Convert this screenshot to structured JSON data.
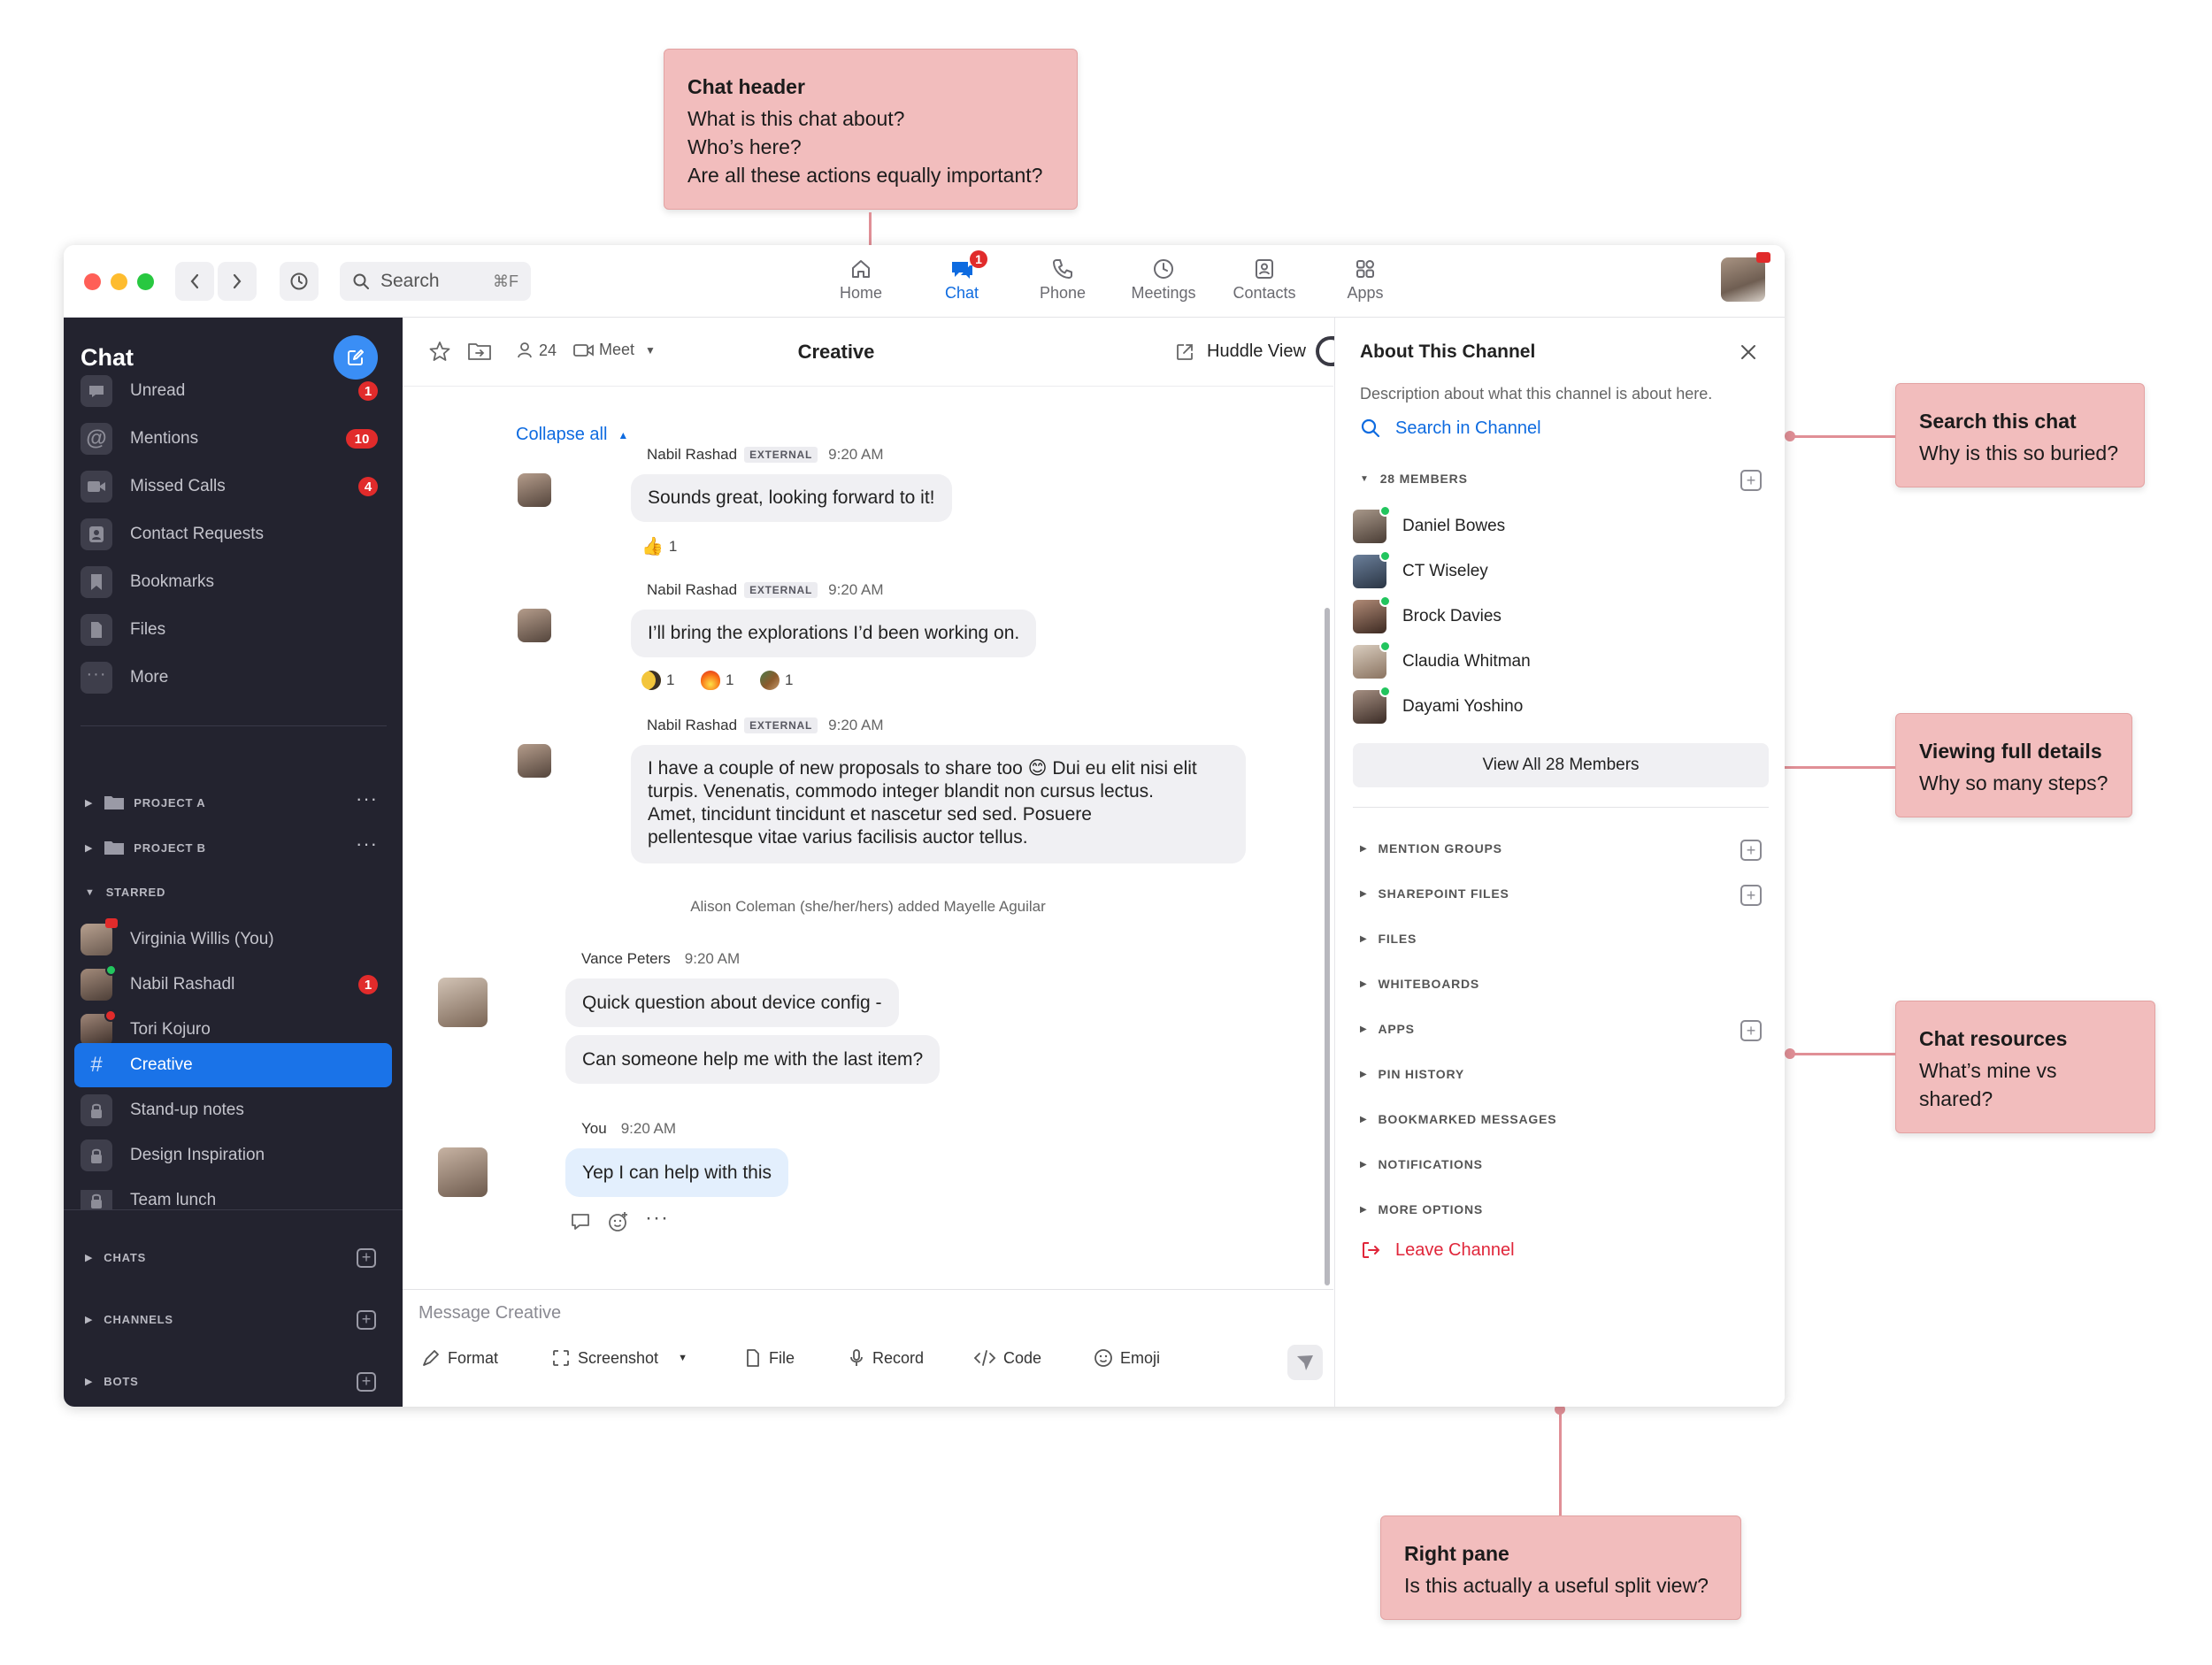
{
  "annotations": [
    {
      "id": "chat-header",
      "title": "Chat header",
      "lines": [
        "What is this chat about?",
        "Who’s here?",
        "Are all these actions equally important?"
      ]
    },
    {
      "id": "search-chat",
      "title": "Search this chat",
      "lines": [
        "Why is this so buried?"
      ]
    },
    {
      "id": "full-details",
      "title": "Viewing full details",
      "lines": [
        "Why so many steps?"
      ]
    },
    {
      "id": "chat-resources",
      "title": "Chat resources",
      "lines": [
        "What’s mine vs shared?"
      ]
    },
    {
      "id": "right-pane",
      "title": "Right pane",
      "lines": [
        "Is this actually a useful split view?"
      ]
    }
  ],
  "topbar": {
    "search_placeholder": "Search",
    "search_shortcut": "⌘F",
    "tabs": [
      {
        "label": "Home",
        "icon": "home-icon"
      },
      {
        "label": "Chat",
        "icon": "chat-icon",
        "badge": "1",
        "active": true
      },
      {
        "label": "Phone",
        "icon": "phone-icon"
      },
      {
        "label": "Meetings",
        "icon": "clock-icon"
      },
      {
        "label": "Contacts",
        "icon": "contacts-icon"
      },
      {
        "label": "Apps",
        "icon": "apps-icon"
      }
    ]
  },
  "sidebar": {
    "title": "Chat",
    "items": [
      {
        "label": "Unread",
        "badge": "1",
        "icon": "speech-bubble-icon"
      },
      {
        "label": "Mentions",
        "badge": "10",
        "icon": "at-icon"
      },
      {
        "label": "Missed Calls",
        "badge": "4",
        "icon": "video-camera-icon"
      },
      {
        "label": "Contact Requests",
        "icon": "person-icon"
      },
      {
        "label": "Bookmarks",
        "icon": "bookmark-icon"
      },
      {
        "label": "Files",
        "icon": "file-icon"
      },
      {
        "label": "More",
        "icon": "ellipsis-icon"
      }
    ],
    "folders": [
      {
        "label": "PROJECT A"
      },
      {
        "label": "PROJECT B"
      }
    ],
    "starred_label": "STARRED",
    "starred": [
      {
        "label": "Virginia Willis (You)"
      },
      {
        "label": "Nabil Rashadl",
        "badge": "1"
      },
      {
        "label": "Tori Kojuro"
      }
    ],
    "channels": [
      {
        "label": "Creative",
        "active": true
      },
      {
        "label": "Stand-up notes"
      },
      {
        "label": "Design Inspiration"
      },
      {
        "label": "Team lunch"
      }
    ],
    "sections": [
      {
        "label": "CHATS"
      },
      {
        "label": "CHANNELS"
      },
      {
        "label": "BOTS"
      }
    ]
  },
  "chat": {
    "member_count": "24",
    "meet_label": "Meet",
    "title": "Creative",
    "huddle_label": "Huddle View",
    "collapse_label": "Collapse all",
    "external_tag": "EXTERNAL",
    "messages": [
      {
        "sender": "Nabil Rashad",
        "time": "9:20 AM",
        "text": "Sounds great, looking forward to it!",
        "reactions": [
          "1"
        ]
      },
      {
        "sender": "Nabil Rashad",
        "time": "9:20 AM",
        "text": "I’ll bring the explorations I’d been working on.",
        "reactions": [
          "1",
          "1",
          "1"
        ]
      },
      {
        "sender": "Nabil Rashad",
        "time": "9:20 AM",
        "lines": [
          "I have a couple of new proposals to share too 😊 Dui eu elit nisi elit",
          "turpis. Venenatis, commodo integer blandit non cursus lectus.",
          "Amet, tincidunt tincidunt et nascetur sed sed. Posuere",
          "pellentesque vitae varius facilisis auctor tellus."
        ]
      }
    ],
    "system_message": "Alison Coleman (she/her/hers) added Mayelle Aguilar",
    "vance": {
      "sender": "Vance Peters",
      "time": "9:20 AM",
      "texts": [
        "Quick question about device config -",
        "Can someone help me with the last item?"
      ]
    },
    "you": {
      "sender": "You",
      "time": "9:20 AM",
      "text": "Yep I can help with this"
    },
    "composer_placeholder": "Message Creative",
    "tools": [
      "Format",
      "Screenshot",
      "File",
      "Record",
      "Code",
      "Emoji"
    ]
  },
  "right_pane": {
    "title": "About This Channel",
    "description": "Description about what this channel is about here.",
    "search_label": "Search in Channel",
    "members_label": "28 MEMBERS",
    "members": [
      "Daniel Bowes",
      "CT Wiseley",
      "Brock Davies",
      "Claudia Whitman",
      "Dayami Yoshino"
    ],
    "view_all_label": "View All 28 Members",
    "sections": [
      "MENTION GROUPS",
      "SHAREPOINT FILES",
      "FILES",
      "WHITEBOARDS",
      "APPS",
      "PIN HISTORY",
      "BOOKMARKED MESSAGES",
      "NOTIFICATIONS",
      "MORE OPTIONS"
    ],
    "leave_label": "Leave Channel"
  },
  "colors": {
    "accent": "#0e6be0",
    "sidebar_bg": "#23232f",
    "danger": "#e0263a",
    "callout": "#f2bdbd"
  }
}
